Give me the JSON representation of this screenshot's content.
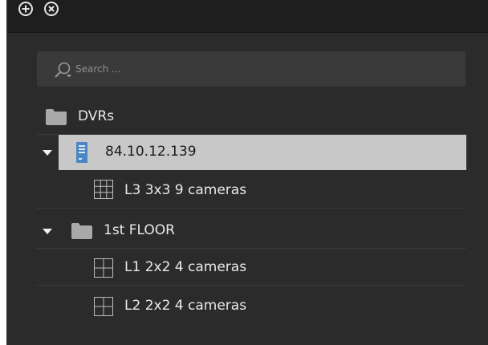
{
  "toolbar": {
    "add_icon": "plus-circle-icon",
    "close_icon": "x-circle-icon"
  },
  "search": {
    "placeholder": "Search ...",
    "value": ""
  },
  "tree": {
    "dvrs_group": {
      "label": "DVRs",
      "icon": "folder-icon"
    },
    "dvr_host": {
      "label": "84.10.12.139",
      "icon": "server-icon",
      "expanded": true,
      "selected": true
    },
    "dvr_layout": {
      "label": "L3 3x3 9 cameras",
      "icon": "grid-3x3-icon"
    },
    "floor_group": {
      "label": "1st FLOOR",
      "icon": "folder-icon",
      "expanded": true
    },
    "floor_layout_1": {
      "label": "L1 2x2 4 cameras",
      "icon": "grid-2x2-icon"
    },
    "floor_layout_2": {
      "label": "L2 2x2 4 cameras",
      "icon": "grid-2x2-icon"
    }
  },
  "colors": {
    "panel_bg": "#2b2b2b",
    "toolbar_bg": "#1e1e1e",
    "search_bg": "#3a3a3a",
    "selection_bg": "#c8c8c8",
    "server_icon": "#4a87c4",
    "folder_icon": "#a9a9a9"
  }
}
